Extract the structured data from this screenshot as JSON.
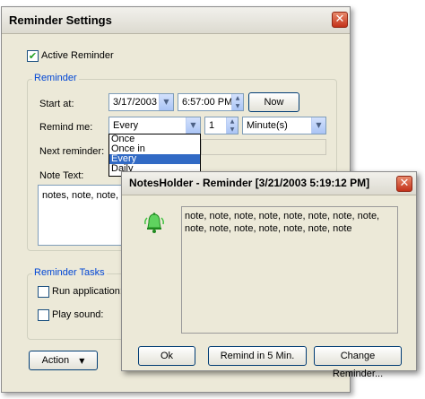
{
  "settings_window": {
    "title": "Reminder Settings",
    "close_glyph": "✕",
    "active_reminder": {
      "label": "Active Reminder",
      "checked": true,
      "check_glyph": "✔"
    },
    "reminder_group": {
      "legend": "Reminder",
      "start_at_label": "Start at:",
      "start_date": "3/17/2003",
      "start_time": "6:57:00 PM",
      "now_button": "Now",
      "remind_me_label": "Remind me:",
      "remind_me_value": "Every",
      "interval_value": "1",
      "unit_value": "Minute(s)",
      "dropdown_options": [
        "Once",
        "Once in",
        "Every",
        "Daily"
      ],
      "dropdown_selected": "Every",
      "next_reminder_label": "Next reminder:",
      "note_text_label": "Note Text:",
      "note_text_value": "notes, note, note, recall"
    },
    "tasks_group": {
      "legend": "Reminder Tasks",
      "run_application_label": "Run application:",
      "play_sound_label": "Play sound:"
    },
    "action_button": "Action",
    "action_arrow": "▼",
    "dropdown_arrow": "▼",
    "spin_up": "▲",
    "spin_down": "▼"
  },
  "popup_window": {
    "title": "NotesHolder - Reminder [3/21/2003 5:19:12 PM]",
    "close_glyph": "✕",
    "icon": "bell-icon",
    "note_text": "note, note, note, note, note, note, note, note, note, note, note, note, note, note, note",
    "buttons": {
      "ok": "Ok",
      "remind_later": "Remind in 5 Min.",
      "change": "Change Reminder..."
    }
  },
  "colors": {
    "window_bg": "#ece9d8",
    "group_legend": "#0046d5",
    "selection": "#316ac5",
    "close_button": "#c3321a",
    "bell": "#3fc23f"
  }
}
